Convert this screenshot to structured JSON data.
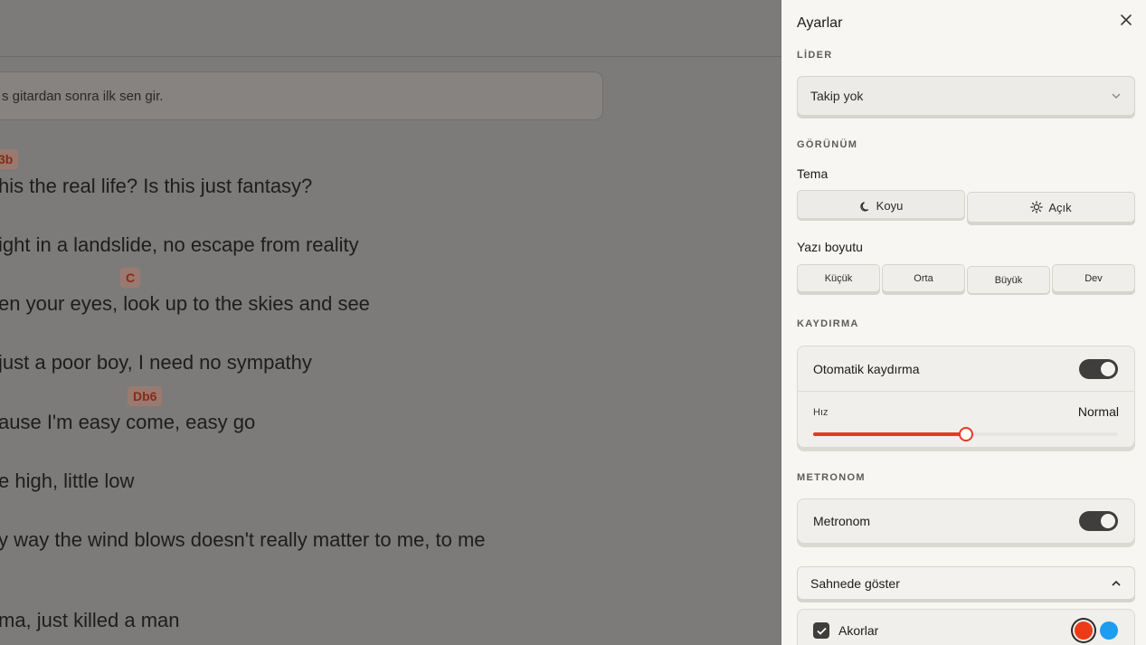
{
  "lyrics_page": {
    "note": "s gitardan sonra ilk sen gir.",
    "lines": [
      "his the real life? Is this just fantasy?",
      "ight in a landslide, no escape from reality",
      "en your eyes, look up to the skies and see",
      "just a poor boy, I need no sympathy",
      "ause I'm easy come, easy go",
      "e high, little low",
      "y way the wind blows doesn't really matter to me, to me",
      "ma, just killed a man"
    ],
    "chords": [
      "3b",
      "C",
      "Db6"
    ]
  },
  "settings": {
    "title": "Ayarlar",
    "close_icon": "close-icon",
    "leader": {
      "section": "LİDER",
      "select_value": "Takip yok"
    },
    "appearance": {
      "section": "GÖRÜNÜM",
      "theme_label": "Tema",
      "theme_options": [
        "Koyu",
        "Açık"
      ],
      "theme_selected": "Koyu",
      "font_label": "Yazı boyutu",
      "font_options": [
        "Küçük",
        "Orta",
        "Büyük",
        "Dev"
      ],
      "font_selected": "Büyük"
    },
    "scroll": {
      "section": "KAYDIRMA",
      "auto_label": "Otomatik kaydırma",
      "auto_on": true,
      "speed_label": "Hız",
      "speed_value": "Normal",
      "speed_level": 0.5
    },
    "metronome": {
      "section": "METRONOM",
      "label": "Metronom",
      "on": true
    },
    "stage": {
      "header": "Sahnede göster",
      "chords_label": "Akorlar",
      "chords_checked": true,
      "colors": [
        "#ee3a16",
        "#1e9cf0"
      ]
    }
  }
}
